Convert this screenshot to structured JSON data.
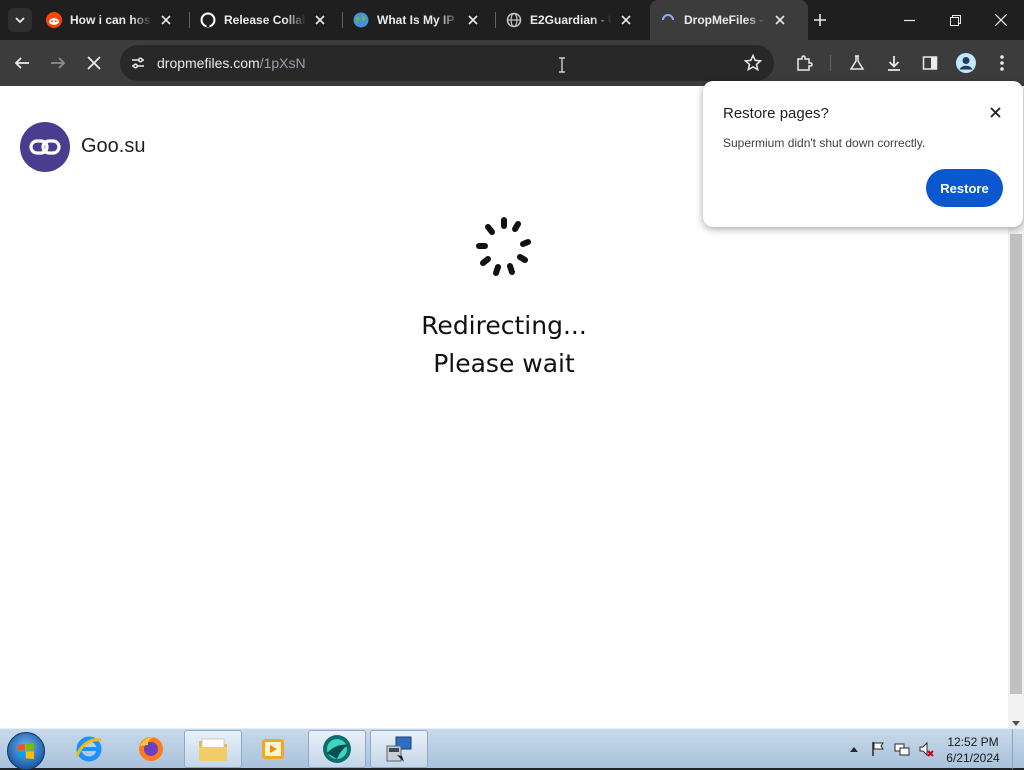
{
  "tabs": [
    {
      "title": "How i can host",
      "icon": "reddit-icon"
    },
    {
      "title": "Release Collab",
      "icon": "github-icon"
    },
    {
      "title": "What Is My IP",
      "icon": "globe-icon"
    },
    {
      "title": "E2Guardian - U",
      "icon": "globe-outline-icon"
    },
    {
      "title": "DropMeFiles -",
      "icon": "loading-icon",
      "active": true
    }
  ],
  "address_bar": {
    "domain": "dropmefiles.com",
    "path": "/1pXsN"
  },
  "page": {
    "brand": "Goo.su",
    "message_line1": "Redirecting...",
    "message_line2": "Please wait"
  },
  "restore_bubble": {
    "title": "Restore pages?",
    "text": "Supermium didn't shut down correctly.",
    "button": "Restore"
  },
  "taskbar": {
    "time": "12:52 PM",
    "date": "6/21/2024"
  },
  "colors": {
    "accent": "#0b57d0",
    "brand_logo": "#4a3d8f",
    "browser_frame": "#1f1f1f"
  }
}
